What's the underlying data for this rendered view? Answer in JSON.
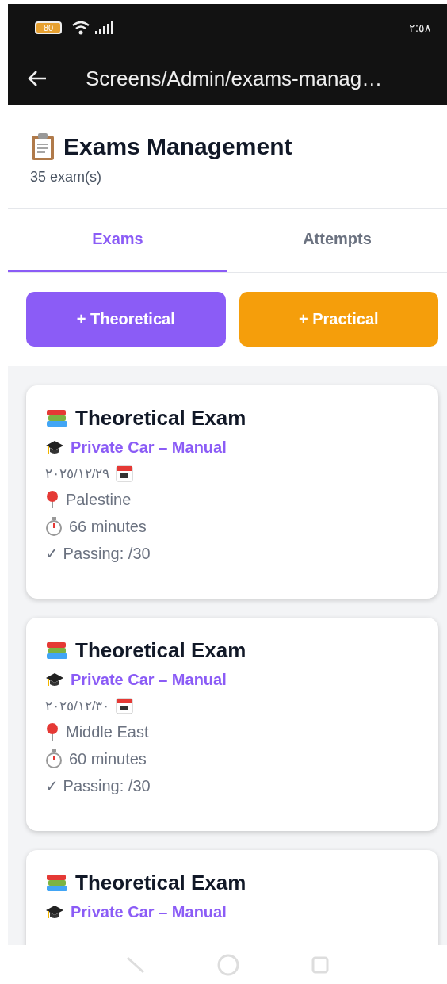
{
  "status_bar": {
    "battery": "80",
    "time": "٢:٥٨"
  },
  "app_bar": {
    "title": "Screens/Admin/exams-manag…"
  },
  "header": {
    "title": "Exams Management",
    "count": "35 exam(s)"
  },
  "tabs": [
    {
      "label": "Exams",
      "selected": true
    },
    {
      "label": "Attempts",
      "selected": false
    }
  ],
  "actions": [
    {
      "label": "+ Theoretical",
      "color": "#8b5cf6"
    },
    {
      "label": "+ Practical",
      "color": "#f59e0b"
    }
  ],
  "exams": [
    {
      "title": "Theoretical Exam",
      "category": "Private Car – Manual",
      "details": [
        {
          "kind": "date",
          "text": "٢٠٢٥/١٢/٢٩"
        },
        {
          "kind": "location",
          "text": "Palestine"
        },
        {
          "kind": "duration",
          "text": "66 minutes"
        },
        {
          "kind": "passing",
          "text": "✓ Passing: /30"
        }
      ]
    },
    {
      "title": "Theoretical Exam",
      "category": "Private Car – Manual",
      "details": [
        {
          "kind": "date",
          "text": "٢٠٢٥/١٢/٣٠"
        },
        {
          "kind": "location",
          "text": "Middle East"
        },
        {
          "kind": "duration",
          "text": "60 minutes"
        },
        {
          "kind": "passing",
          "text": "✓ Passing: /30"
        }
      ]
    },
    {
      "title": "Theoretical Exam",
      "category": "Private Car – Manual"
    }
  ]
}
